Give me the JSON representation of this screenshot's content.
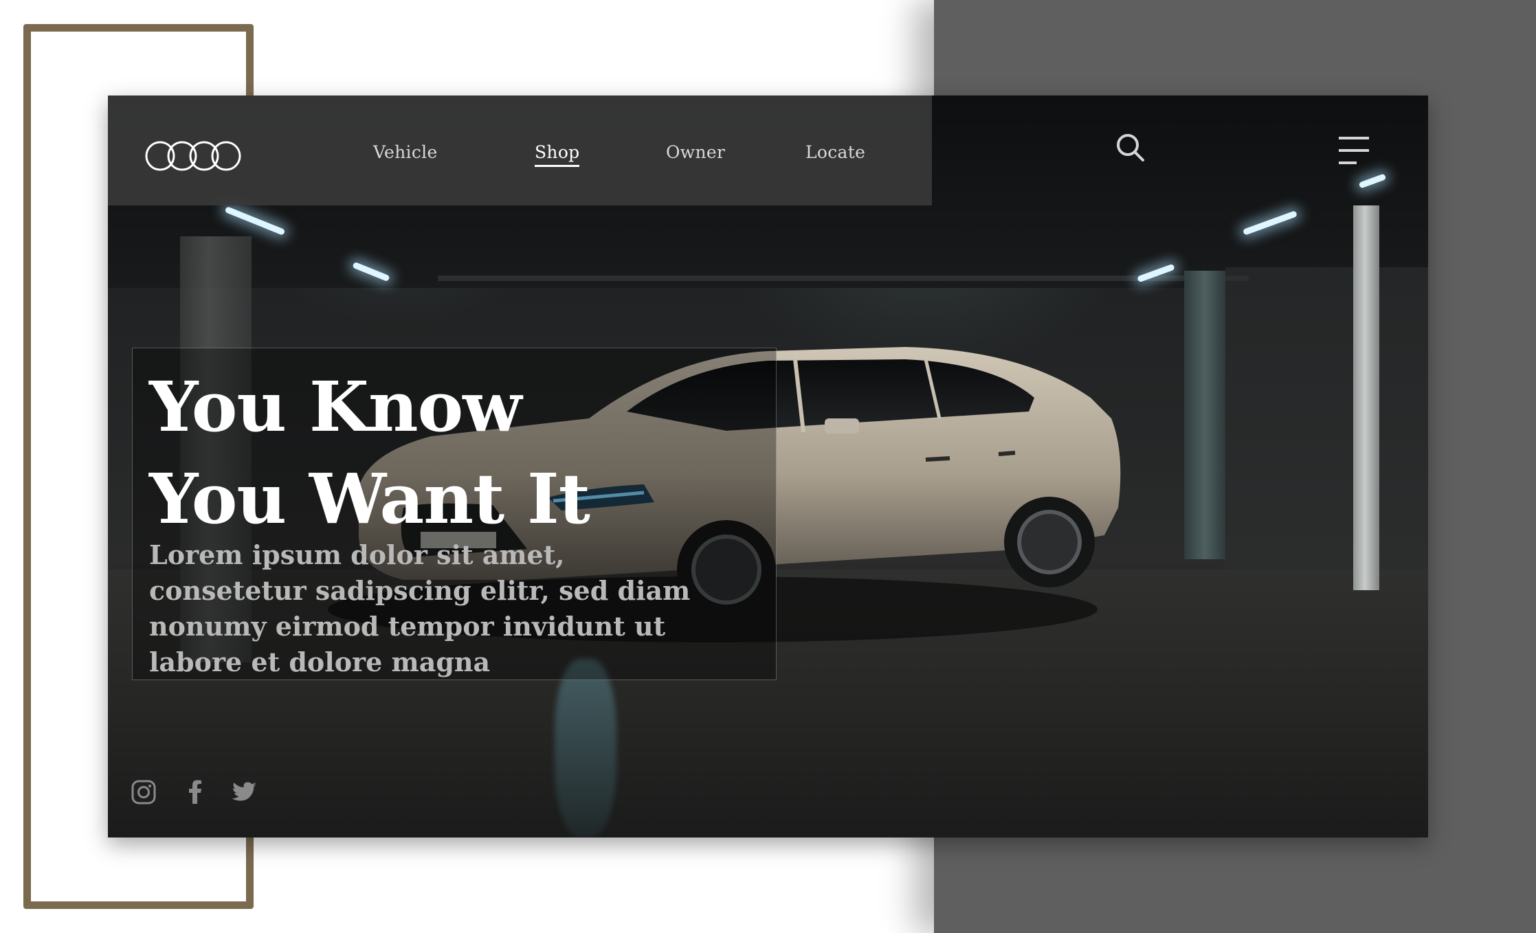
{
  "nav": {
    "items": [
      {
        "label": "Vehicle",
        "active": false
      },
      {
        "label": "Shop",
        "active": true
      },
      {
        "label": "Owner",
        "active": false
      },
      {
        "label": "Locate",
        "active": false
      }
    ]
  },
  "hero": {
    "headline_line1": "You Know",
    "headline_line2": "You Want It",
    "subcopy": "Lorem ipsum dolor sit amet, consetetur sadipscing elitr, sed diam nonumy eirmod tempor invidunt ut labore et dolore magna"
  },
  "icons": {
    "logo": "four-rings-logo",
    "search": "search-icon",
    "menu": "hamburger-menu-icon",
    "social": [
      "instagram-icon",
      "facebook-icon",
      "twitter-icon"
    ]
  },
  "colors": {
    "frame": "#7a6a4f",
    "backdrop_right": "#5f5f5f",
    "nav_bar": "#3a3a3a",
    "headline": "#ffffff",
    "subcopy": "#b9b9b9"
  }
}
